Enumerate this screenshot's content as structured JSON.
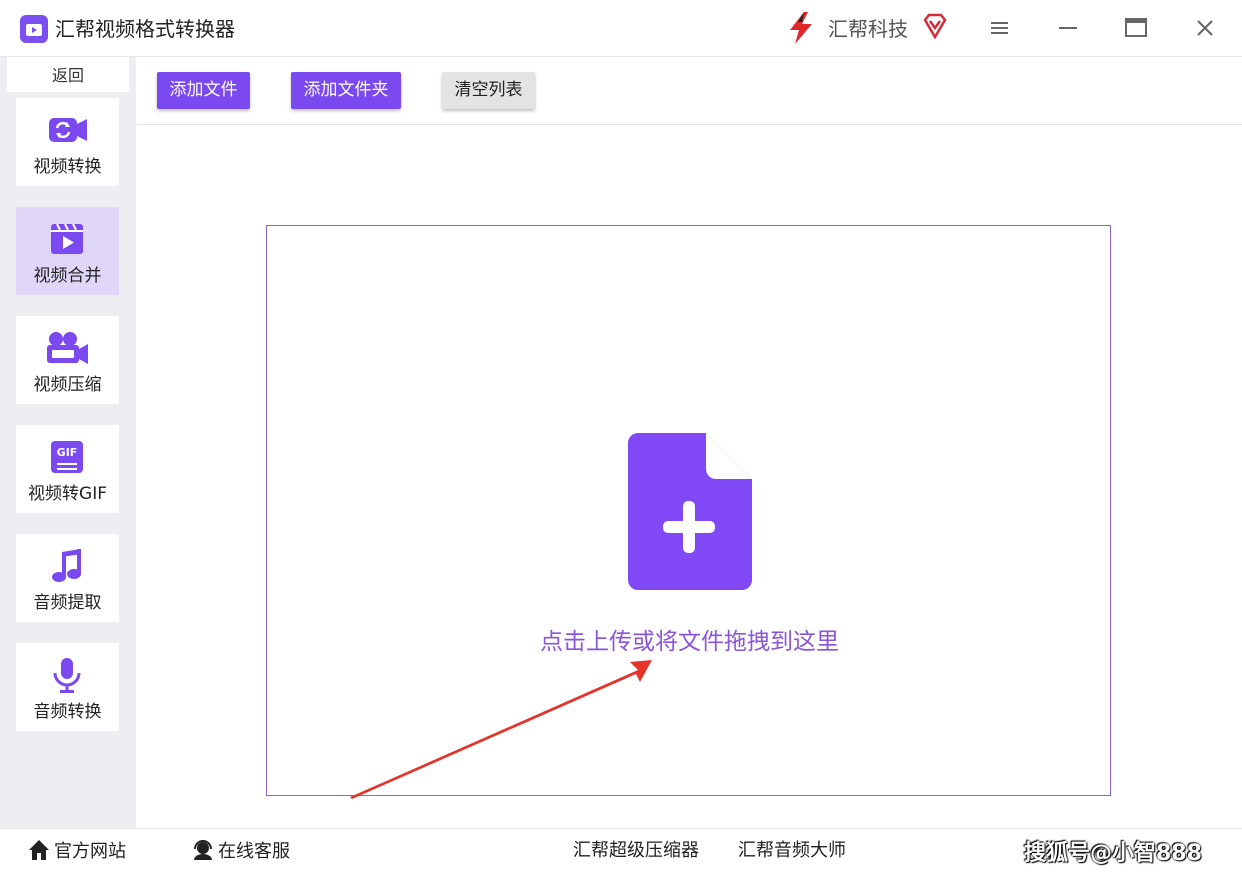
{
  "window": {
    "title": "汇帮视频格式转换器",
    "brand_name": "汇帮科技",
    "accent_color": "#7a49ef"
  },
  "sidebar": {
    "back_label": "返回",
    "items": [
      {
        "label": "视频转换",
        "icon": "video-convert-icon",
        "active": false
      },
      {
        "label": "视频合并",
        "icon": "video-merge-icon",
        "active": true
      },
      {
        "label": "视频压缩",
        "icon": "video-camera-icon",
        "active": false
      },
      {
        "label": "视频转GIF",
        "icon": "gif-icon",
        "active": false
      },
      {
        "label": "音频提取",
        "icon": "music-note-icon",
        "active": false
      },
      {
        "label": "音频转换",
        "icon": "microphone-icon",
        "active": false
      }
    ]
  },
  "toolbar": {
    "add_file": "添加文件",
    "add_folder": "添加文件夹",
    "clear_list": "清空列表"
  },
  "dropzone": {
    "text": "点击上传或将文件拖拽到这里",
    "icon": "file-add-icon"
  },
  "footer": {
    "official_site": "官方网站",
    "online_service": "在线客服",
    "link_compressor": "汇帮超级压缩器",
    "link_audio": "汇帮音频大师",
    "watermark": "搜狐号@小智888"
  }
}
